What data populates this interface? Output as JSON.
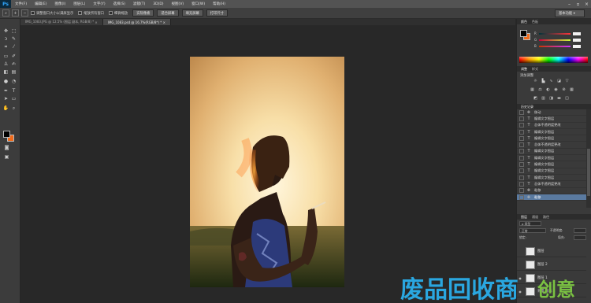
{
  "app": {
    "logo": "Ps"
  },
  "menubar": {
    "items": [
      "文件(F)",
      "编辑(E)",
      "图像(I)",
      "图层(L)",
      "文字(Y)",
      "选择(S)",
      "滤镜(T)",
      "3D(D)",
      "视图(V)",
      "窗口(W)",
      "帮助(H)"
    ],
    "window_buttons": [
      "minimize-icon",
      "maximize-icon",
      "close-icon"
    ]
  },
  "options": {
    "check_1": "调整窗口大小以满屏显示",
    "check_2": "缩放所有窗口",
    "check_3": "细微缩放",
    "btn_actual": "实际像素",
    "btn_fit": "适合屏幕",
    "btn_fill": "填充屏幕",
    "btn_print": "打印尺寸",
    "workspace": "基本功能"
  },
  "tabs": [
    {
      "label": "IMG_1083.JPG @ 12.5% (图层 副本, RGB/8) *",
      "active": false
    },
    {
      "label": "IMG_1083.psd @ 16.7%(RGB/8*) *",
      "active": true
    }
  ],
  "colors": {
    "foreground": "#000000",
    "background": "#f06a1a",
    "panel_fg": "#000000",
    "panel_bg": "#f06a1a"
  },
  "color_panel": {
    "tab_1": "颜色",
    "tab_2": "色板",
    "channels": [
      {
        "label": "R",
        "track": "linear-gradient(to right,#00343a,#ff343a)"
      },
      {
        "label": "G",
        "track": "linear-gradient(to right,#c8003a,#c8ff3a)"
      },
      {
        "label": "B",
        "track": "linear-gradient(to right,#c83400,#c834ff)"
      }
    ]
  },
  "adjust_panel": {
    "tab_1": "调整",
    "tab_2": "样式",
    "title": "添加调整"
  },
  "history_panel": {
    "tab_1": "历史记录",
    "rows": [
      {
        "icon": "move-icon",
        "label": "移动",
        "selected": false
      },
      {
        "icon": "text-icon",
        "label": "编辑文字图层",
        "selected": false
      },
      {
        "icon": "text-icon",
        "label": "总体不透明度更改",
        "selected": false
      },
      {
        "icon": "text-icon",
        "label": "编辑文字图层",
        "selected": false
      },
      {
        "icon": "text-icon",
        "label": "编辑文字图层",
        "selected": false
      },
      {
        "icon": "text-icon",
        "label": "总体不透明度更改",
        "selected": false
      },
      {
        "icon": "text-icon",
        "label": "编辑文字图层",
        "selected": false
      },
      {
        "icon": "text-icon",
        "label": "编辑文字图层",
        "selected": false
      },
      {
        "icon": "text-icon",
        "label": "编辑文字图层",
        "selected": false
      },
      {
        "icon": "text-icon",
        "label": "编辑文字图层",
        "selected": false
      },
      {
        "icon": "text-icon",
        "label": "编辑文字图层",
        "selected": false
      },
      {
        "icon": "text-icon",
        "label": "总体不透明度更改",
        "selected": false
      },
      {
        "icon": "move-icon",
        "label": "粘移",
        "selected": false
      },
      {
        "icon": "move-icon",
        "label": "粘移",
        "selected": true
      }
    ]
  },
  "layers_panel": {
    "tab_1": "图层",
    "tab_2": "通道",
    "tab_3": "路径",
    "filter": "ρ 类型",
    "blend_mode": "正常",
    "opacity_label": "不透明度:",
    "lock_label": "锁定:",
    "fill_label": "填充:",
    "layers": [
      {
        "name": "图层",
        "visible": false
      },
      {
        "name": "图层 2",
        "visible": false
      },
      {
        "name": "图层 1",
        "visible": true
      },
      {
        "name": "背景 副本 2",
        "visible": true
      }
    ]
  },
  "watermark": {
    "text": "废品回收商",
    "suffix": "创意"
  }
}
